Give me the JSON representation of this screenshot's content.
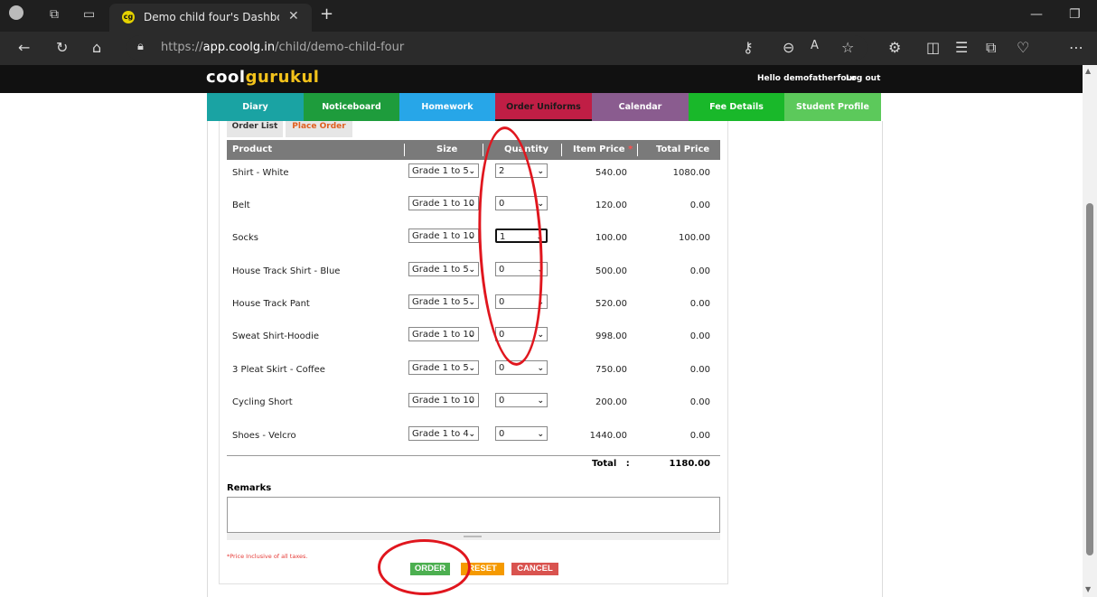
{
  "browser": {
    "tab_title": "Demo child four's Dashboard | C",
    "favicon_text": "cg",
    "url_prefix": "https://",
    "url_domain": "app.coolg.in",
    "url_path": "/child/demo-child-four"
  },
  "site": {
    "logo_cool": "cool",
    "logo_gurukul": "gurukul",
    "greeting": "Hello demofatherfour",
    "logout": "Log out"
  },
  "nav": [
    {
      "label": "Diary",
      "color": "#1aa3a3"
    },
    {
      "label": "Noticeboard",
      "color": "#1e9c3c"
    },
    {
      "label": "Homework",
      "color": "#27a6e8"
    },
    {
      "label": "Order Uniforms",
      "color": "#c01e45"
    },
    {
      "label": "Calendar",
      "color": "#8a5c8f"
    },
    {
      "label": "Fee Details",
      "color": "#19b82a"
    },
    {
      "label": "Student Profile",
      "color": "#5cc95b"
    }
  ],
  "subtabs": {
    "order_list": "Order List",
    "place_order": "Place Order"
  },
  "table": {
    "headers": [
      "Product",
      "Size",
      "Quantity",
      "Item Price",
      "*",
      "Total Price"
    ],
    "rows": [
      {
        "product": "Shirt - White",
        "size": "Grade 1 to 5",
        "qty": "2",
        "price": "540.00",
        "total": "1080.00"
      },
      {
        "product": "Belt",
        "size": "Grade 1 to 10",
        "qty": "0",
        "price": "120.00",
        "total": "0.00"
      },
      {
        "product": "Socks",
        "size": "Grade 1 to 10",
        "qty": "1",
        "price": "100.00",
        "total": "100.00"
      },
      {
        "product": "House Track Shirt - Blue",
        "size": "Grade 1 to 5",
        "qty": "0",
        "price": "500.00",
        "total": "0.00"
      },
      {
        "product": "House Track Pant",
        "size": "Grade 1 to 5",
        "qty": "0",
        "price": "520.00",
        "total": "0.00"
      },
      {
        "product": "Sweat Shirt-Hoodie",
        "size": "Grade 1 to 10",
        "qty": "0",
        "price": "998.00",
        "total": "0.00"
      },
      {
        "product": "3 Pleat Skirt - Coffee",
        "size": "Grade 1 to 5",
        "qty": "0",
        "price": "750.00",
        "total": "0.00"
      },
      {
        "product": "Cycling Short",
        "size": "Grade 1 to 10",
        "qty": "0",
        "price": "200.00",
        "total": "0.00"
      },
      {
        "product": "Shoes - Velcro",
        "size": "Grade 1 to 4",
        "qty": "0",
        "price": "1440.00",
        "total": "0.00"
      }
    ],
    "total_label": "Total   :",
    "total_value": "1180.00"
  },
  "remarks_label": "Remarks",
  "note": "*Price Inclusive of all taxes.",
  "buttons": {
    "order": "ORDER",
    "reset": "RESET",
    "cancel": "CANCEL"
  },
  "colors": {
    "annotation": "#e0161e",
    "order_btn": "#4caf50",
    "reset_btn": "#f59a00",
    "cancel_btn": "#d9534f"
  }
}
